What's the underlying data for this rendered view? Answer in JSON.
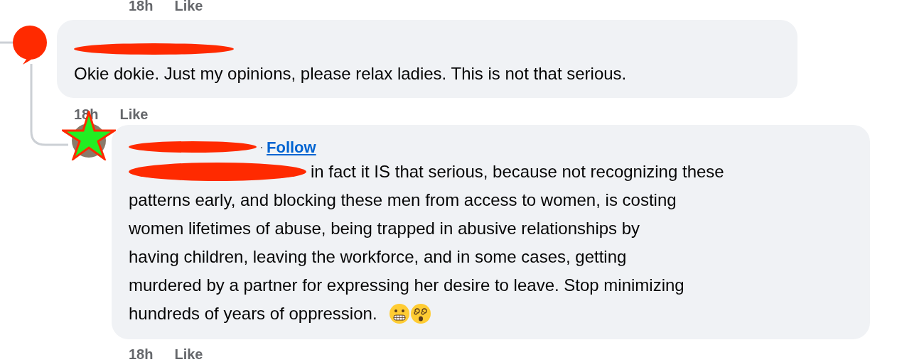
{
  "top_meta": {
    "time": "18h",
    "action": "Like"
  },
  "comments": [
    {
      "avatar": {
        "kind": "blob"
      },
      "name_redacted": true,
      "body_lines": [
        "Okie dokie. Just my opinions, please relax ladies. This is not that serious."
      ],
      "time": "18h",
      "action": "Like"
    },
    {
      "avatar": {
        "kind": "star"
      },
      "name_redacted": true,
      "separator": "·",
      "follow": "Follow",
      "body_redacted_prefix": true,
      "body_lines": [
        "in fact it IS that serious, because not recognizing these",
        "patterns early, and blocking these men from access to women, is costing",
        "women lifetimes of abuse, being trapped in abusive relationships by",
        "having children, leaving the workforce, and in some cases, getting",
        "murdered by a partner for expressing her desire to leave. Stop minimizing",
        "hundreds of years of oppression."
      ],
      "emojis": [
        {
          "kind": "grimace"
        },
        {
          "kind": "dizzy"
        }
      ],
      "time": "18h",
      "action": "Like"
    }
  ]
}
